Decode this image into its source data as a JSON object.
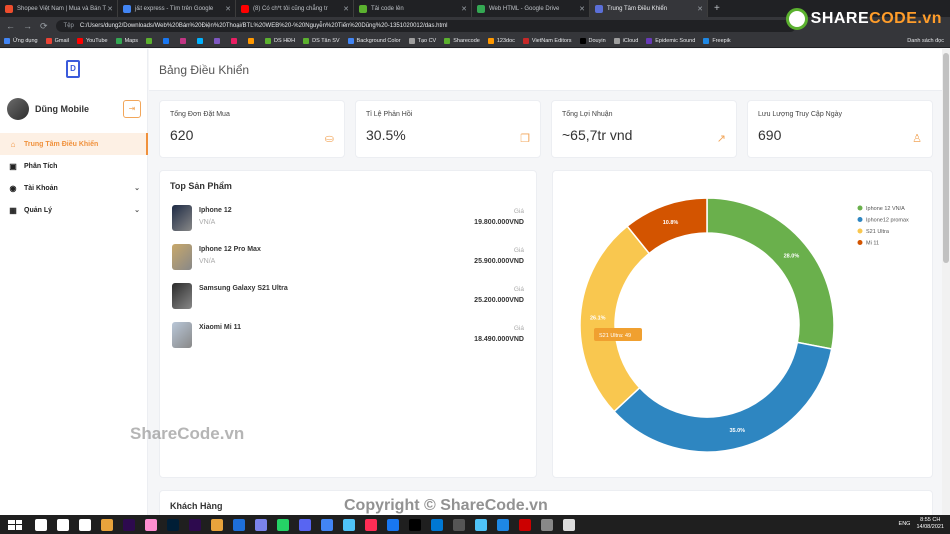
{
  "browser": {
    "tabs": [
      {
        "title": "Shopee Việt Nam | Mua và Bán T",
        "color": "#ee4d2d"
      },
      {
        "title": "j&t express - Tìm trên Google",
        "color": "#4285f4"
      },
      {
        "title": "(8) Có ch*t tôi cũng chẳng tr",
        "color": "#ff0000"
      },
      {
        "title": "Tải code lên",
        "color": "#5bb12f"
      },
      {
        "title": "Web HTML - Google Drive",
        "color": "#34a853"
      },
      {
        "title": "Trung Tâm Điều Khiển",
        "color": "#5b6fd8"
      }
    ],
    "url_label": "Tệp",
    "url": "C:/Users/dung2/Downloads/Web%20Bán%20Điện%20Thoại/BTL%20WEB%20-%20Nguyễn%20Tiến%20Dũng%20-1351020012/das.html",
    "bookmarks": [
      "Ứng dụng",
      "Gmail",
      "YouTube",
      "Maps",
      "",
      "",
      "",
      "",
      "",
      "",
      "",
      "DS HĐH",
      "DS Tân SV",
      "Background Color",
      "Tạo CV",
      "Sharecode",
      "123doc",
      "VietNam Editors",
      "Douyin",
      "iCloud",
      "Epidemic Sound",
      "Freepik"
    ],
    "bookmarks_right": "Danh sách đọc",
    "sharecode_logo": "SHARECODE.vn"
  },
  "sidebar": {
    "profile_name": "Dũng Mobile",
    "menu": [
      {
        "label": "Trung Tâm Điều Khiển",
        "icon": "home-icon",
        "glyph": "⌂",
        "active": true,
        "chevron": false
      },
      {
        "label": "Phân Tích",
        "icon": "chart-icon",
        "glyph": "▣",
        "active": false,
        "chevron": false
      },
      {
        "label": "Tài Khoản",
        "icon": "user-circle-icon",
        "glyph": "◉",
        "active": false,
        "chevron": true
      },
      {
        "label": "Quản Lý",
        "icon": "grid-icon",
        "glyph": "▦",
        "active": false,
        "chevron": true
      }
    ]
  },
  "page_title": "Bảng Điều Khiển",
  "cards": [
    {
      "title": "Tổng Đơn Đặt Mua",
      "value": "620",
      "icon": "shopping-bag-icon",
      "glyph": "⛀"
    },
    {
      "title": "Tỉ Lệ Phản Hồi",
      "value": "30.5%",
      "icon": "chat-icon",
      "glyph": "❐"
    },
    {
      "title": "Tổng Lợi Nhuận",
      "value": "~65,7tr vnd",
      "icon": "trend-icon",
      "glyph": "↗"
    },
    {
      "title": "Lưu Lượng Truy Cập Ngày",
      "value": "690",
      "icon": "person-icon",
      "glyph": "♙"
    }
  ],
  "top_products": {
    "title": "Top Sản Phẩm",
    "price_label": "Giá",
    "items": [
      {
        "name": "Iphone 12",
        "sub": "VN/A",
        "price": "19.800.000VND",
        "color": "#1d2a44"
      },
      {
        "name": "Iphone 12 Pro Max",
        "sub": "VN/A",
        "price": "25.900.000VND",
        "color": "#c8a86a"
      },
      {
        "name": "Samsung Galaxy S21 Ultra",
        "sub": "",
        "price": "25.200.000VND",
        "color": "#2b2b2b"
      },
      {
        "name": "Xiaomi Mi 11",
        "sub": "",
        "price": "18.490.000VND",
        "color": "#b9c7d8"
      }
    ]
  },
  "chart_data": {
    "type": "pie",
    "title": "",
    "legend_position": "top-right",
    "tooltip": "S21 Ultra: 49",
    "slices": [
      {
        "name": "Iphone 12 VN/A",
        "value": 28.0,
        "label": "28.0%",
        "color": "#6ab04c"
      },
      {
        "name": "Iphone12 promax",
        "value": 35.0,
        "label": "35.0%",
        "color": "#2e86c1"
      },
      {
        "name": "S21 Ultra",
        "value": 26.1,
        "label": "26.1%",
        "color": "#f9c74f"
      },
      {
        "name": "Mi 11",
        "value": 10.8,
        "label": "10.8%",
        "color": "#d35400"
      }
    ]
  },
  "customers": {
    "title": "Khách Hàng"
  },
  "watermark": "ShareCode.vn",
  "copyright": "Copyright © ShareCode.vn",
  "taskbar": {
    "lang": "ENG",
    "time": "8:55 CH",
    "date": "14/08/2021"
  }
}
